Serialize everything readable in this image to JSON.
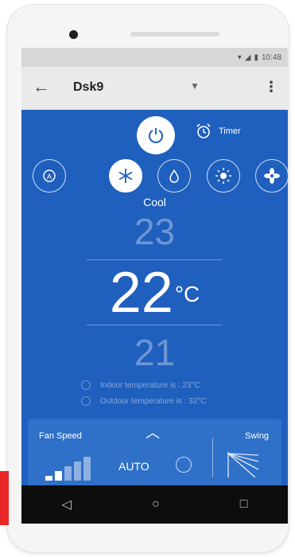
{
  "status": {
    "time": "10:48"
  },
  "appbar": {
    "device_name": "Dsk9"
  },
  "timer": {
    "label": "Timer"
  },
  "mode": {
    "current": "Cool",
    "items": [
      {
        "name": "auto-mode",
        "icon": "auto-icon"
      },
      {
        "name": "cool-mode",
        "icon": "snowflake-icon",
        "active": true
      },
      {
        "name": "dry-mode",
        "icon": "drop-icon"
      },
      {
        "name": "heat-mode",
        "icon": "sun-icon"
      },
      {
        "name": "fan-mode",
        "icon": "fan-icon"
      }
    ]
  },
  "temperature": {
    "above": "23",
    "set": "22",
    "unit": "°C",
    "below": "21"
  },
  "readouts": {
    "indoor": "Indoor temperature is : 23°C",
    "outdoor": "Outdoor temperature is : 32°C"
  },
  "panel": {
    "fan_speed_label": "Fan Speed",
    "fan_speed_value": "AUTO",
    "swing_label": "Swing"
  },
  "colors": {
    "accent": "#1f5fbd",
    "panel": "#2f70c8",
    "nav": "#0d0d0d"
  }
}
